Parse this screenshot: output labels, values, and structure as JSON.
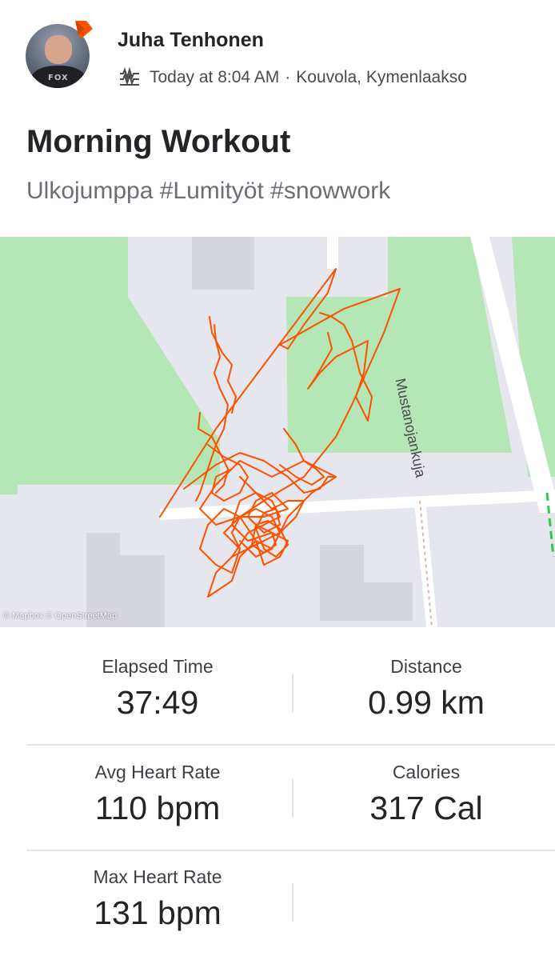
{
  "athlete": {
    "name": "Juha Tenhonen",
    "avatar_shirt_text": "FOX",
    "badge_icon": "subscriber-chevron-icon"
  },
  "meta": {
    "activity_icon": "workout-waves-icon",
    "time": "Today at 8:04 AM",
    "separator": "·",
    "location": "Kouvola, Kymenlaakso"
  },
  "activity": {
    "title": "Morning Workout",
    "description": "Ulkojumppa #Lumityöt #snowwork"
  },
  "map": {
    "street_label": "Mustanojankuja",
    "attribution": "© Mapbox © OpenStreetMap",
    "route_color": "#fc5200",
    "park_color": "#b4e6b6",
    "road_color": "#e6e6f0"
  },
  "stats": [
    {
      "label": "Elapsed Time",
      "value": "37:49"
    },
    {
      "label": "Distance",
      "value": "0.99 km"
    },
    {
      "label": "Avg Heart Rate",
      "value": "110 bpm"
    },
    {
      "label": "Calories",
      "value": "317 Cal"
    },
    {
      "label": "Max Heart Rate",
      "value": "131 bpm"
    }
  ]
}
